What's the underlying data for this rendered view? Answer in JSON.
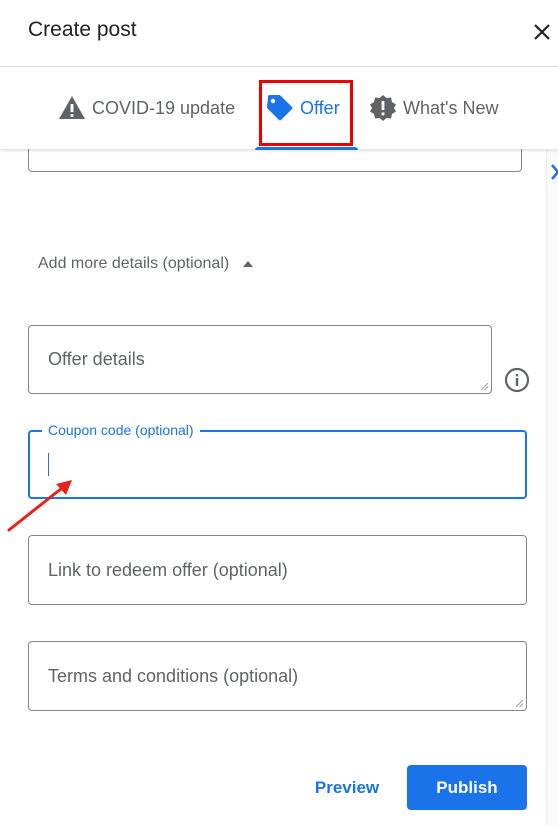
{
  "header": {
    "title": "Create post",
    "close_icon": "close-icon"
  },
  "tabs": [
    {
      "label": "COVID-19 update",
      "icon": "warning-icon",
      "active": false
    },
    {
      "label": "Offer",
      "icon": "tag-icon",
      "active": true
    },
    {
      "label": "What's New",
      "icon": "alert-badge-icon",
      "active": false
    }
  ],
  "tab_overflow_icon": "chevron-right-icon",
  "more_details": {
    "label": "Add more details (optional)",
    "icon": "caret-up-icon"
  },
  "fields": {
    "offer_details": {
      "placeholder": "Offer details",
      "value": ""
    },
    "coupon_code": {
      "label": "Coupon code (optional)",
      "value": ""
    },
    "link": {
      "placeholder": "Link to redeem offer (optional)",
      "value": ""
    },
    "terms": {
      "placeholder": "Terms and conditions (optional)",
      "value": ""
    }
  },
  "info_icon": "info-icon",
  "buttons": {
    "preview": "Preview",
    "publish": "Publish"
  },
  "colors": {
    "accent": "#1a73e8",
    "annotation": "#ee0000"
  }
}
